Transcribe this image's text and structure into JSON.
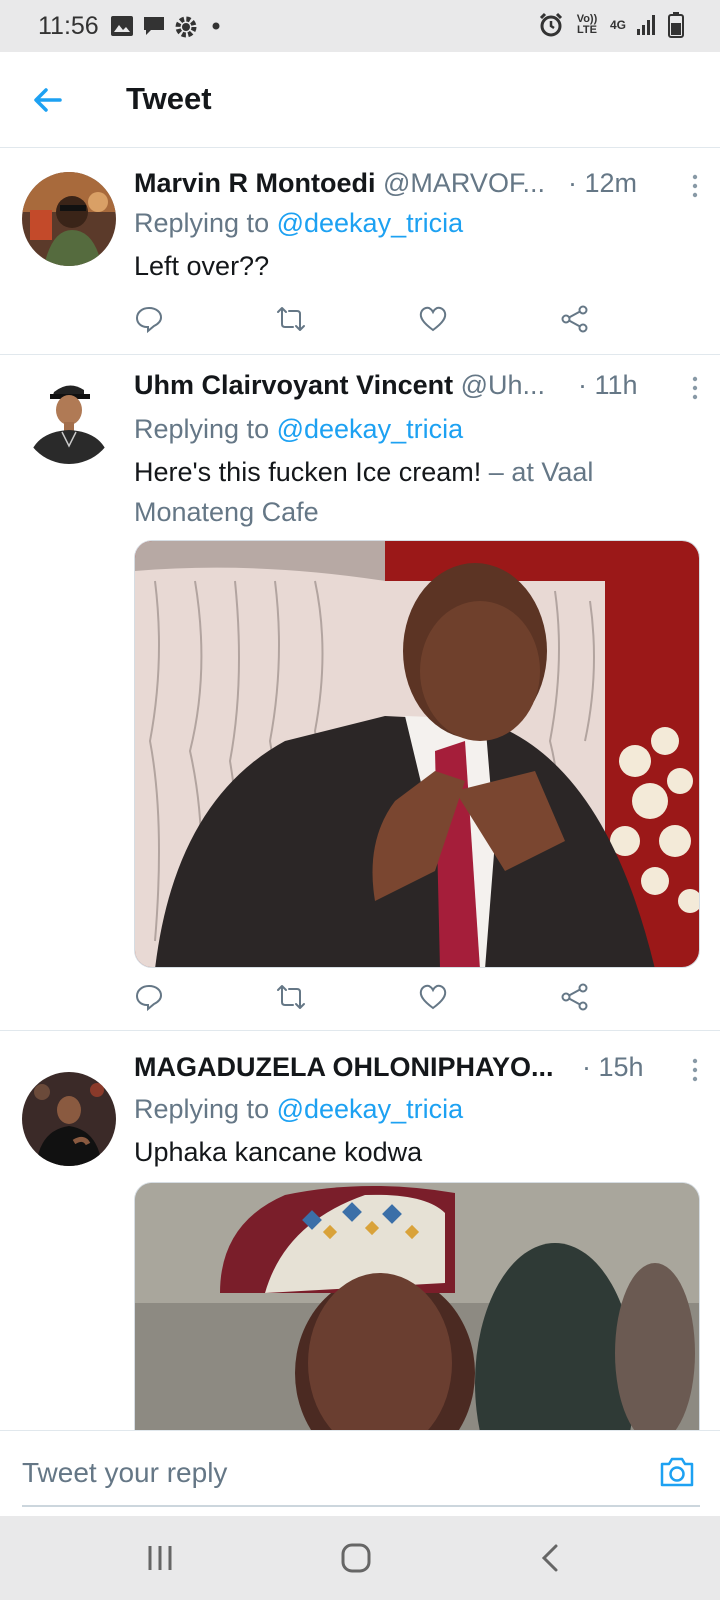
{
  "status_bar": {
    "time": "11:56",
    "left_icons": [
      "image-icon",
      "message-icon",
      "settings-icon",
      "dot-icon"
    ],
    "right_icons": [
      "alarm-icon",
      "volte-icon",
      "4g-icon",
      "signal-icon",
      "battery-icon"
    ],
    "volte_label": "Vo)) LTE",
    "network_label": "4G"
  },
  "header": {
    "title": "Tweet",
    "back_icon": "arrow-left-icon"
  },
  "tweets": [
    {
      "name": "Marvin R Montoedi",
      "handle": "@MARVOF...",
      "time": "· 12m",
      "replying_prefix": "Replying to ",
      "replying_to": "@deekay_tricia",
      "text": "Left over??",
      "location": ""
    },
    {
      "name": "Uhm Clairvoyant Vincent",
      "handle": "@Uh...",
      "time": "· 11h",
      "replying_prefix": "Replying to ",
      "replying_to": "@deekay_tricia",
      "text": "Here's this fucken Ice cream! ",
      "location": "– at Vaal Monateng Cafe"
    },
    {
      "name": "MAGADUZELA OHLONIPHAYO...",
      "handle": "",
      "time": "· 15h",
      "replying_prefix": "Replying to ",
      "replying_to": "@deekay_tricia",
      "text": "Uphaka kancane kodwa",
      "location": ""
    }
  ],
  "reply_bar": {
    "placeholder": "Tweet your reply",
    "camera_icon": "camera-icon"
  },
  "nav_bar": {
    "icons": [
      "recents-icon",
      "home-icon",
      "back-icon"
    ]
  },
  "colors": {
    "accent": "#1da1f2",
    "secondary_text": "#657786",
    "primary_text": "#14171a",
    "divider": "#e1e8ed",
    "system_bar": "#e9e9ea"
  }
}
